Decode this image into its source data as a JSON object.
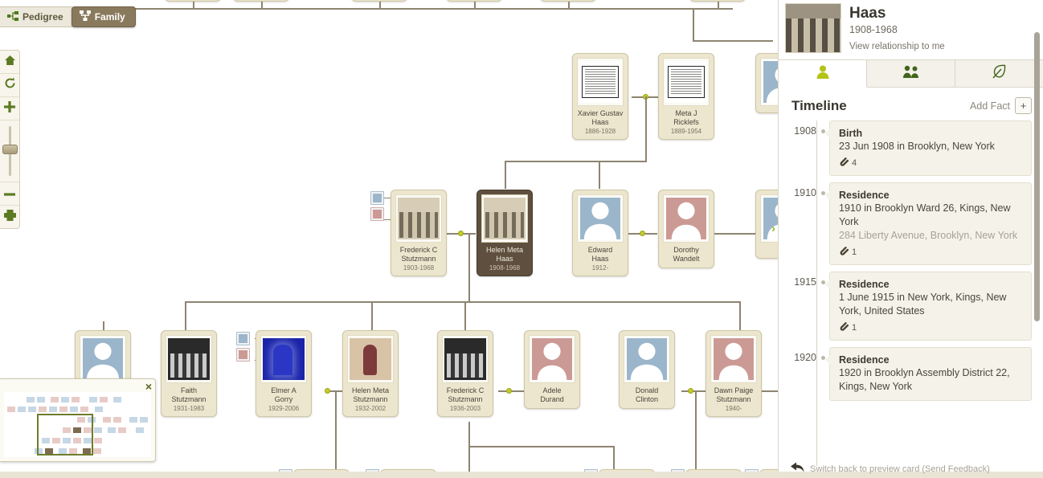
{
  "view_tabs": [
    {
      "label": "Pedigree",
      "icon": "pedigree-icon",
      "active": false
    },
    {
      "label": "Family",
      "icon": "family-tree-icon",
      "active": true
    }
  ],
  "left_toolbar": [
    {
      "name": "home-icon",
      "title": "Home"
    },
    {
      "name": "refresh-icon",
      "title": "Reset"
    },
    {
      "name": "zoom-in-icon",
      "title": "Zoom in"
    },
    {
      "name": "zoom-slider",
      "title": "Zoom level"
    },
    {
      "name": "zoom-out-icon",
      "title": "Zoom out"
    },
    {
      "name": "print-icon",
      "title": "Print"
    }
  ],
  "minimap": {
    "close_label": "×"
  },
  "tree": {
    "grandparents": [
      {
        "name_line1": "Xavier Gustav",
        "name_line2": "Haas",
        "dates": "1886-1928",
        "photo": "doc",
        "gender": "m"
      },
      {
        "name_line1": "Meta J",
        "name_line2": "Ricklefs",
        "dates": "1889-1954",
        "photo": "doc",
        "gender": "f"
      }
    ],
    "parents_row": [
      {
        "name_line1": "Frederick C",
        "name_line2": "Stutzmann",
        "dates": "1903-1968",
        "photo": "grp",
        "gender": "m",
        "selected": false
      },
      {
        "name_line1": "Helen Meta",
        "name_line2": "Haas",
        "dates": "1908-1968",
        "photo": "grp",
        "gender": "f",
        "selected": true
      },
      {
        "name_line1": "Edward",
        "name_line2": "Haas",
        "dates": "1912-",
        "photo": "avatar",
        "gender": "m",
        "selected": false
      },
      {
        "name_line1": "Dorothy",
        "name_line2": "Wandelt",
        "dates": "",
        "photo": "avatar",
        "gender": "f",
        "selected": false
      }
    ],
    "children_row": [
      {
        "name_line1": "Faith",
        "name_line2": "Stutzmann",
        "dates": "1931-1983",
        "photo": "bw",
        "gender": "f"
      },
      {
        "name_line1": "Elmer A",
        "name_line2": "Gorry",
        "dates": "1929-2006",
        "photo": "blue",
        "gender": "m"
      },
      {
        "name_line1": "Helen Meta",
        "name_line2": "Stutzmann",
        "dates": "1932-2002",
        "photo": "tin",
        "gender": "f"
      },
      {
        "name_line1": "Frederick C",
        "name_line2": "Stutzmann",
        "dates": "1936-2003",
        "photo": "bw",
        "gender": "m"
      },
      {
        "name_line1": "Adele",
        "name_line2": "Durand",
        "dates": "",
        "photo": "avatar",
        "gender": "f"
      },
      {
        "name_line1": "Donald",
        "name_line2": "Clinton",
        "dates": "",
        "photo": "avatar",
        "gender": "m"
      },
      {
        "name_line1": "Dawn Paige",
        "name_line2": "Stutzmann",
        "dates": "1940-",
        "photo": "avatar",
        "gender": "f"
      }
    ],
    "expand_chevron": "›"
  },
  "panel": {
    "person_name": "Haas",
    "person_dates": "1908-1968",
    "relationship_link": "View relationship to me",
    "tabs": [
      {
        "icon": "person-icon",
        "active": true
      },
      {
        "icon": "family-group-icon",
        "active": false
      },
      {
        "icon": "leaf-hint-icon",
        "active": false
      }
    ],
    "timeline_title": "Timeline",
    "add_fact_label": "Add Fact",
    "add_fact_button": "+",
    "events": [
      {
        "year": "1908",
        "title": "Birth",
        "description": "23 Jun 1908 in Brooklyn, New York",
        "sub": "",
        "attachments": "4"
      },
      {
        "year": "1910",
        "title": "Residence",
        "description": "1910 in Brooklyn Ward 26, Kings, New York",
        "sub": "284 Liberty Avenue, Brooklyn, New York",
        "attachments": "1"
      },
      {
        "year": "1915",
        "title": "Residence",
        "description": "1 June 1915 in New York, Kings, New York, United States",
        "sub": "",
        "attachments": "1"
      },
      {
        "year": "1920",
        "title": "Residence",
        "description": "1920 in Brooklyn Assembly District 22, Kings, New York",
        "sub": "",
        "attachments": ""
      }
    ]
  },
  "feedback": {
    "text": "Switch back to preview card  (Send Feedback)",
    "icon": "back-arrow-icon"
  },
  "colors": {
    "card_bg": "#ece6cf",
    "card_selected_bg": "#5e4f3e",
    "connector": "#8d8471",
    "join_dot": "#c3cc2b",
    "accent_green": "#6f8a2e",
    "male": "#9bb6cb",
    "female": "#cb9a95",
    "active_tab_brown": "#8a7a5d"
  }
}
